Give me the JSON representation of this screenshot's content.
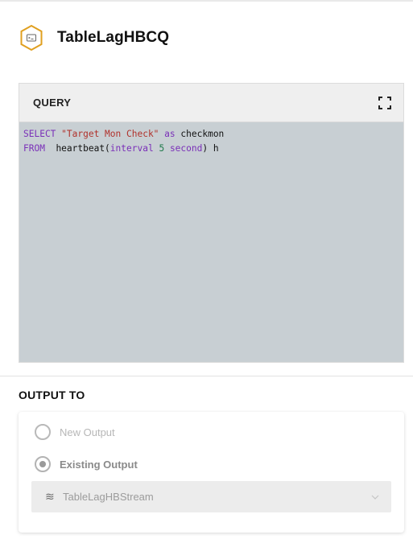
{
  "header": {
    "title": "TableLagHBCQ",
    "icon": "hexagon-query-icon"
  },
  "query": {
    "title": "QUERY",
    "expand_icon": "fullscreen-icon",
    "code": {
      "line1": {
        "kw1": "SELECT",
        "str1": "\"Target Mon Check\"",
        "kw2": "as",
        "ident1": "checkmon"
      },
      "line2": {
        "kw1": "FROM",
        "ident1": "heartbeat(",
        "kw2": "interval",
        "num1": "5",
        "kw3": "second",
        "ident2": ") h"
      }
    }
  },
  "output": {
    "label": "OUTPUT TO",
    "options": [
      {
        "label": "New Output",
        "selected": false
      },
      {
        "label": "Existing Output",
        "selected": true
      }
    ],
    "stream": {
      "icon": "stream-icon",
      "icon_glyph": "≋",
      "name": "TableLagHBStream"
    }
  },
  "colors": {
    "accent": "#e0a020",
    "keyword": "#7a2fb8",
    "string": "#b0312b",
    "number": "#1f7a4a",
    "editor_bg": "#c8cfd3"
  }
}
